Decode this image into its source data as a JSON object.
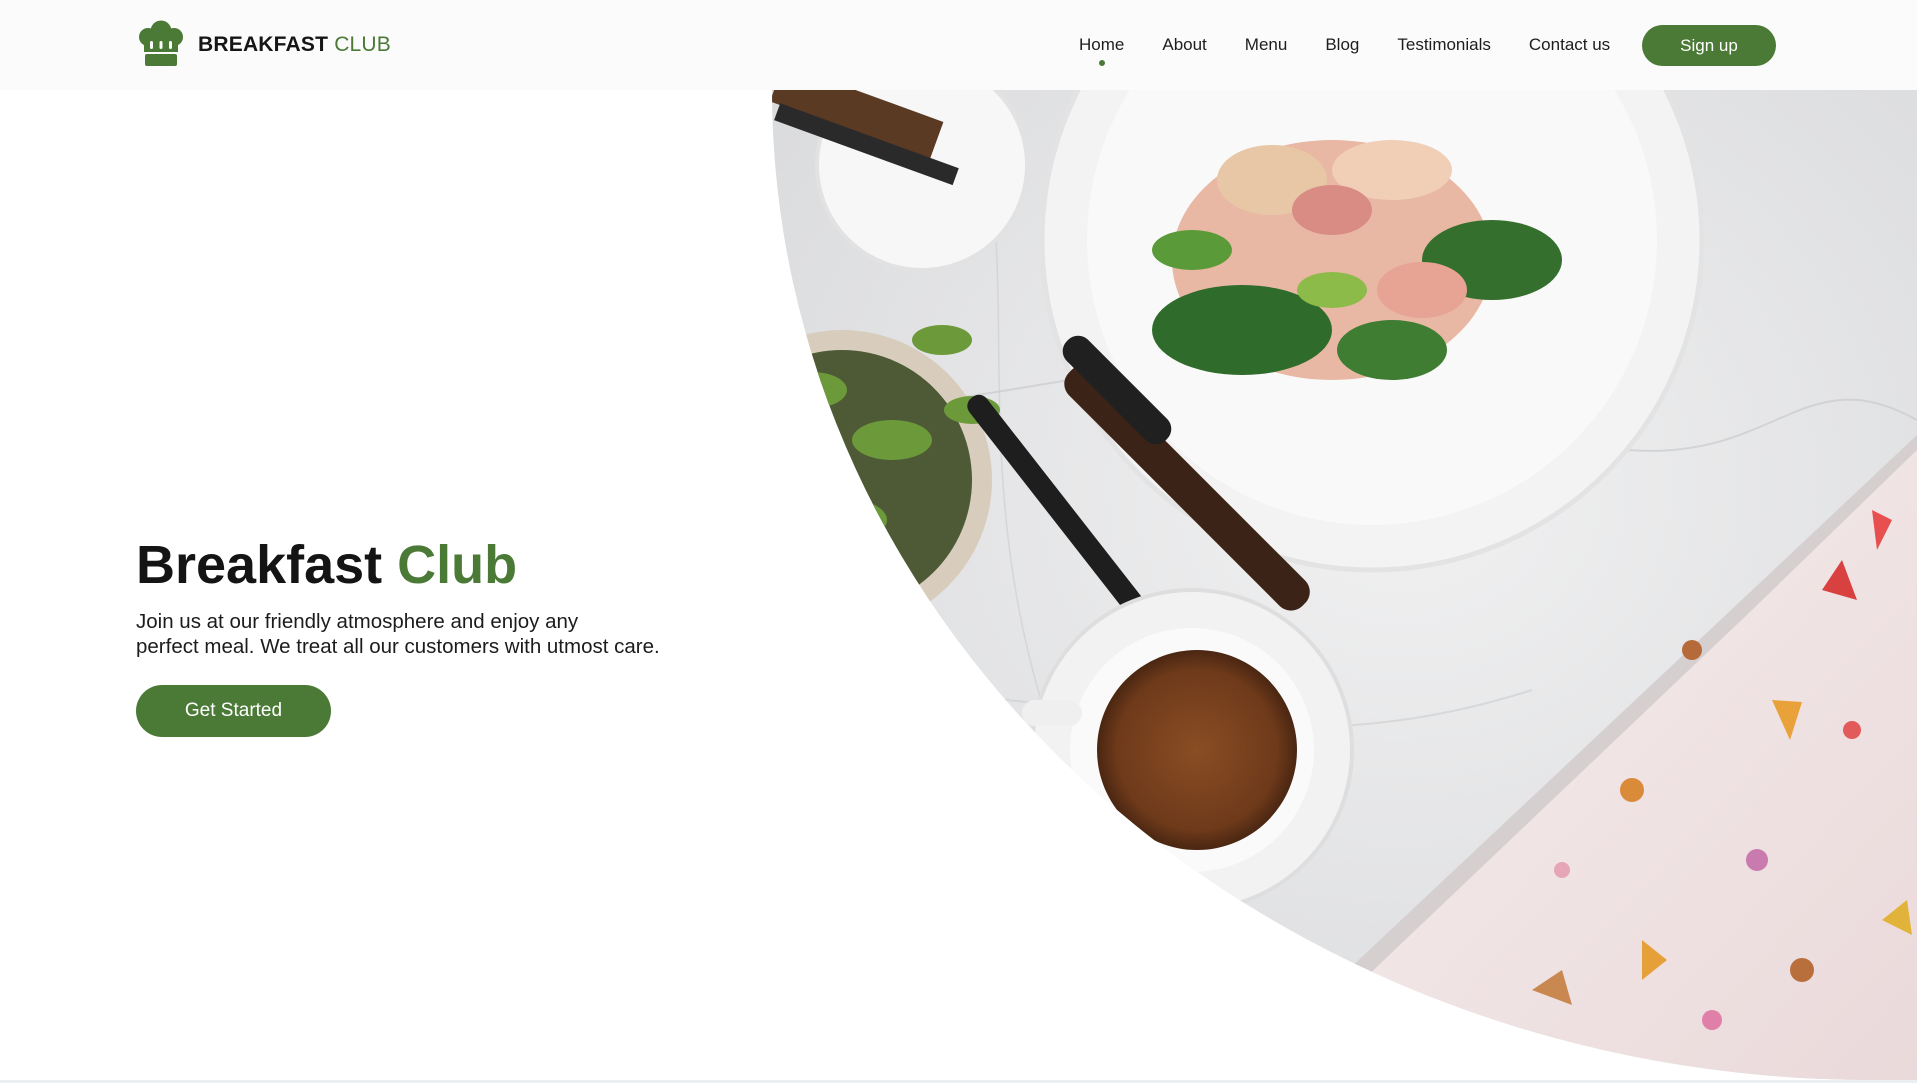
{
  "brand": {
    "word1": "BREAKFAST",
    "word2": "CLUB",
    "icon": "chef-hat-icon"
  },
  "nav": {
    "items": [
      {
        "label": "Home",
        "active": true
      },
      {
        "label": "About",
        "active": false
      },
      {
        "label": "Menu",
        "active": false
      },
      {
        "label": "Blog",
        "active": false
      },
      {
        "label": "Testimonials",
        "active": false
      },
      {
        "label": "Contact us",
        "active": false
      }
    ],
    "signup": "Sign up"
  },
  "hero": {
    "title_main": "Breakfast",
    "title_accent": "Club",
    "subtitle_line1": "Join us at our friendly atmosphere and enjoy any",
    "subtitle_line2": "perfect meal. We treat all our customers with utmost care.",
    "cta": "Get Started"
  },
  "colors": {
    "accent": "#4b7a36",
    "text": "#141414",
    "background": "#ffffff",
    "navbar": "#fbfbfb"
  }
}
